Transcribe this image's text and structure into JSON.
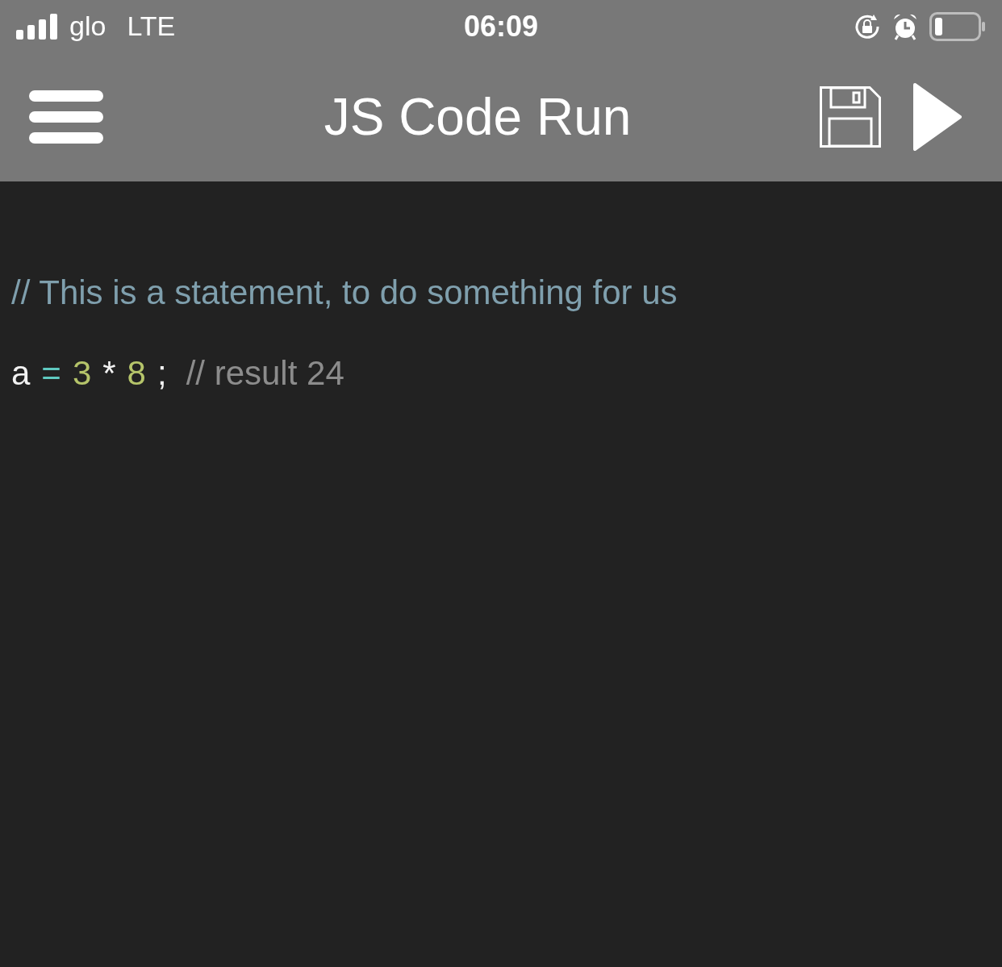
{
  "status_bar": {
    "carrier": "glo",
    "network": "LTE",
    "time": "06:09"
  },
  "app_bar": {
    "title": "JS Code Run"
  },
  "editor": {
    "lines": [
      {
        "tokens": [
          {
            "text": "// This is a statement, to do something for us",
            "color": "#7f9fad"
          }
        ]
      },
      {
        "tokens": [
          {
            "text": "a",
            "color": "#f2f2f2"
          },
          {
            "text": "=",
            "color": "#5fc9c0"
          },
          {
            "text": "3",
            "color": "#b5c46a"
          },
          {
            "text": "*",
            "color": "#f2f2f2"
          },
          {
            "text": "8",
            "color": "#b5c46a"
          },
          {
            "text": ";",
            "color": "#f2f2f2"
          },
          {
            "text": "// result 24",
            "color": "#8c8c8c"
          }
        ]
      }
    ]
  }
}
